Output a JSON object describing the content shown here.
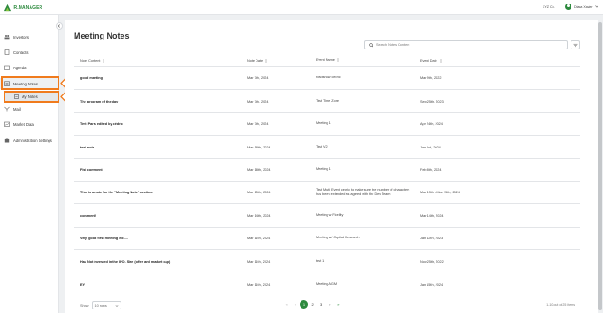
{
  "app": {
    "logo_text": "IR.MANAGER",
    "company": "XYZ Co.",
    "user_name": "Diana Xavier"
  },
  "colors": {
    "brand": "#2d8a3e",
    "highlight": "#f07b1d"
  },
  "sidebar": {
    "items": [
      {
        "label": "Investors",
        "icon": "people-icon"
      },
      {
        "label": "Contacts",
        "icon": "contacts-icon"
      },
      {
        "label": "Agenda",
        "icon": "calendar-icon"
      },
      {
        "label": "Meeting Notes",
        "icon": "notes-icon"
      },
      {
        "label": "My Notes",
        "icon": "note-icon"
      },
      {
        "label": "Mail",
        "icon": "mail-icon"
      },
      {
        "label": "Market Data",
        "icon": "chart-icon"
      },
      {
        "label": "Administration Settings",
        "icon": "settings-icon"
      }
    ]
  },
  "page": {
    "title": "Meeting Notes"
  },
  "search": {
    "placeholder": "Search Notes Content"
  },
  "table": {
    "headers": {
      "content": "Note Content",
      "date": "Note Date",
      "event_name": "Event Name",
      "event_date": "Event Date"
    },
    "rows": [
      {
        "content": "good meeting",
        "date": "Mar 7th, 2024",
        "event_name": "roadshow cédric",
        "event_date": "Mar 9th, 2022"
      },
      {
        "content": "The program of the day",
        "date": "Mar 7th, 2024",
        "event_name": "Test Time Zone",
        "event_date": "Sep 25th, 2023"
      },
      {
        "content": "Test Paris edited by cédric",
        "date": "Mar 7th, 2024",
        "event_name": "Meeting 1",
        "event_date": "Apr 24th, 2024"
      },
      {
        "content": "test note",
        "date": "Mar 18th, 2024",
        "event_name": "Test V2",
        "event_date": "Jan 1st, 2024"
      },
      {
        "content": "Fist comment",
        "date": "Mar 18th, 2024",
        "event_name": "Meeting 1",
        "event_date": "Feb 8th, 2024"
      },
      {
        "content": "This is a note for the \"Meeting Note\" section.",
        "date": "Mar 15th, 2024",
        "event_name": "Test Multi Event cedric to make sure the number of characters has been extended as agreed with the Dev Team",
        "event_date": "Mar 13th - Mar 15th, 2024"
      },
      {
        "content": "comment!",
        "date": "Mar 14th, 2024",
        "event_name": "Meeting w Fidelity",
        "event_date": "Mar 14th, 2024"
      },
      {
        "content": "Very good first meeting etc....",
        "date": "Mar 11th, 2024",
        "event_name": "Meeting w/ Capital Research",
        "event_date": "Jan 12th, 2023"
      },
      {
        "content": "Has Not invested in the IPO. Size (offer and market cap)",
        "date": "Mar 11th, 2024",
        "event_name": "test 1",
        "event_date": "Nov 25th, 2022"
      },
      {
        "content": "EY",
        "date": "Mar 11th, 2024",
        "event_name": "Meeting AGM",
        "event_date": "Jan 15th, 2024"
      }
    ]
  },
  "footer": {
    "show_label": "Show",
    "rows_value": "10 rows",
    "pages": [
      "1",
      "2",
      "3"
    ],
    "current_page": "1",
    "range_text": "1-10 out of 25 items"
  }
}
